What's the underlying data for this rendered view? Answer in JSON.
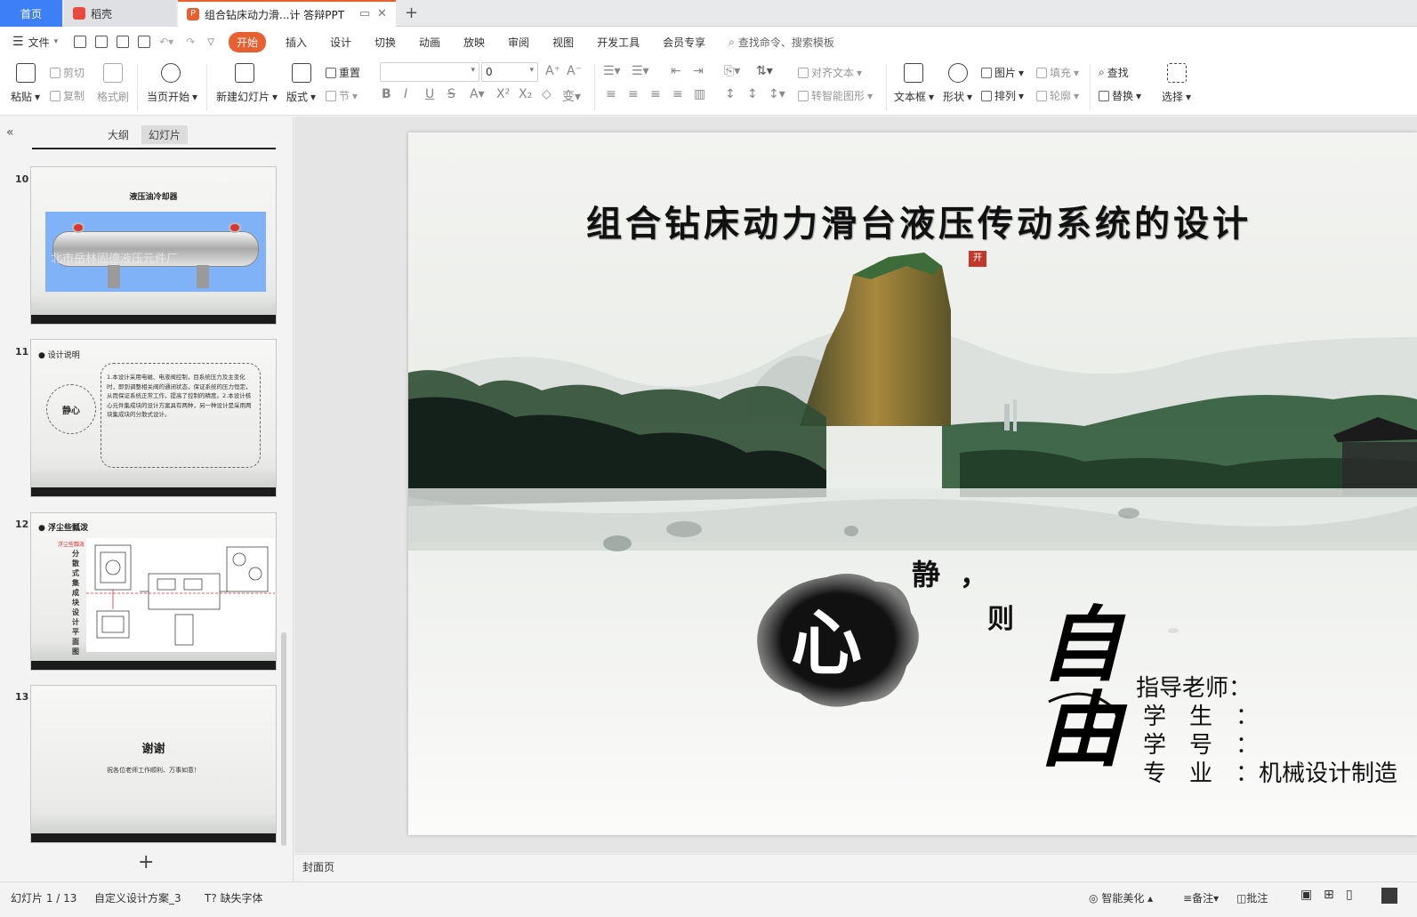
{
  "tabs": {
    "home": "首页",
    "docer": "稻壳",
    "document": "组合钻床动力滑...计 答辩PPT"
  },
  "menu": {
    "file": "文件",
    "items": [
      "插入",
      "设计",
      "切换",
      "动画",
      "放映",
      "审阅",
      "视图",
      "开发工具",
      "会员专享"
    ],
    "active": "开始",
    "search": "查找命令、搜索模板"
  },
  "ribbon": {
    "paste": "粘贴",
    "cut": "剪切",
    "copy": "复制",
    "format_painter": "格式刷",
    "from_current": "当页开始",
    "new_slide": "新建幻灯片",
    "layout": "版式",
    "reset": "重置",
    "section": "节",
    "font_size": "0",
    "align_text": "对齐文本",
    "smartart": "转智能图形",
    "textbox": "文本框",
    "shape": "形状",
    "picture": "图片",
    "arrange": "排列",
    "fill": "填充",
    "outline": "轮廓",
    "find": "查找",
    "replace": "替换",
    "select": "选择"
  },
  "sidebar": {
    "tab_outline": "大纲",
    "tab_slides": "幻灯片",
    "slides": [
      {
        "num": "10",
        "title": "液压油冷却器",
        "watermark": "北市岳林固德液压元件厂"
      },
      {
        "num": "11",
        "heading": "设计说明",
        "circle": "静心",
        "body": "1.本设计采用电磁、电液阀控制，目系统压力及主变化时，即到调整相关阀的通闭状态，保证系统的压力恒定，从而保证系统正常工作，提高了控制的精度。2.本设计核心元件集成块的设计方案具有两种，另一种设计是采用两块集成块的分散式设计。"
      },
      {
        "num": "12",
        "heading": "浮尘些瓢泼",
        "sub": "浮尘些瓢泼",
        "vertical": "分散式集成块设计平面图"
      },
      {
        "num": "13",
        "thanks": "谢谢",
        "sub": "祝各位老师工作顺利、万事如意！"
      }
    ]
  },
  "slide": {
    "title": "组合钻床动力滑台液压传动系统的设计",
    "seal": "开",
    "xin": "心",
    "jing": "静",
    "comma": "，",
    "ze": "则",
    "ziyou": "自由",
    "advisor": "指导老师：",
    "student": "学　生　：",
    "student_id": "学　号　：",
    "major": "专　业　：机械设计制造"
  },
  "notes_label": "封面页",
  "status": {
    "slide_counter": "幻灯片 1 / 13",
    "theme": "自定义设计方案_3",
    "missing_font": "缺失字体",
    "beautify": "智能美化",
    "notes": "备注",
    "comments": "批注"
  },
  "colors": {
    "accent": "#3d7ff7",
    "start_tab": "#e8602f",
    "seal": "#c0392b"
  }
}
